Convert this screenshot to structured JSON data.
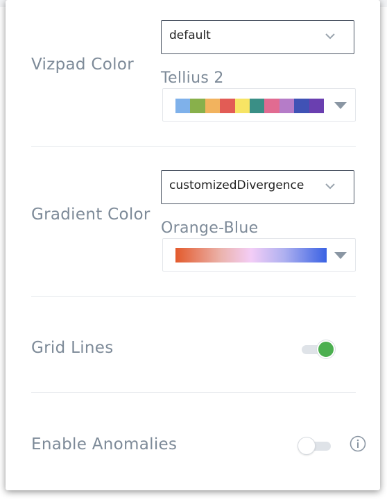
{
  "vizpad_color": {
    "label": "Vizpad Color",
    "select_value": "default",
    "palette_name": "Tellius 2",
    "swatches": [
      "#7fb1ea",
      "#88b04b",
      "#f2b35e",
      "#e25c55",
      "#f7e464",
      "#3a8f86",
      "#e16b91",
      "#b57cc8",
      "#4052b5",
      "#6a3fb0"
    ]
  },
  "gradient_color": {
    "label": "Gradient Color",
    "select_value": "customizedDivergence",
    "palette_name": "Orange-Blue"
  },
  "grid_lines": {
    "label": "Grid Lines",
    "enabled": true
  },
  "anomalies": {
    "label": "Enable Anomalies",
    "enabled": false
  },
  "colors": {
    "toggle_on": "#4caf50",
    "toggle_on_track": "#dfe3e8",
    "toggle_off_track": "#dfe3e8",
    "label_text": "#7d8a98"
  }
}
